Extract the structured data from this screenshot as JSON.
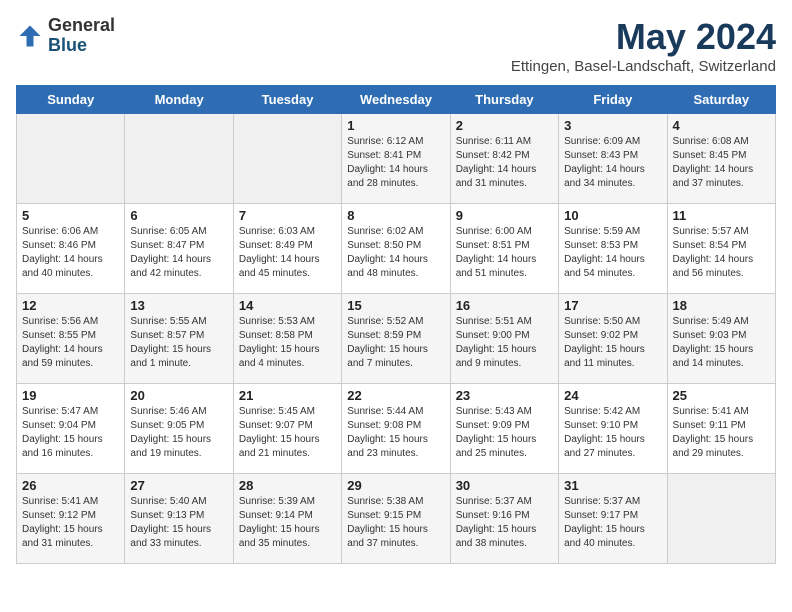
{
  "logo": {
    "general": "General",
    "blue": "Blue"
  },
  "title": "May 2024",
  "subtitle": "Ettingen, Basel-Landschaft, Switzerland",
  "days_of_week": [
    "Sunday",
    "Monday",
    "Tuesday",
    "Wednesday",
    "Thursday",
    "Friday",
    "Saturday"
  ],
  "weeks": [
    [
      {
        "day": "",
        "info": ""
      },
      {
        "day": "",
        "info": ""
      },
      {
        "day": "",
        "info": ""
      },
      {
        "day": "1",
        "info": "Sunrise: 6:12 AM\nSunset: 8:41 PM\nDaylight: 14 hours\nand 28 minutes."
      },
      {
        "day": "2",
        "info": "Sunrise: 6:11 AM\nSunset: 8:42 PM\nDaylight: 14 hours\nand 31 minutes."
      },
      {
        "day": "3",
        "info": "Sunrise: 6:09 AM\nSunset: 8:43 PM\nDaylight: 14 hours\nand 34 minutes."
      },
      {
        "day": "4",
        "info": "Sunrise: 6:08 AM\nSunset: 8:45 PM\nDaylight: 14 hours\nand 37 minutes."
      }
    ],
    [
      {
        "day": "5",
        "info": "Sunrise: 6:06 AM\nSunset: 8:46 PM\nDaylight: 14 hours\nand 40 minutes."
      },
      {
        "day": "6",
        "info": "Sunrise: 6:05 AM\nSunset: 8:47 PM\nDaylight: 14 hours\nand 42 minutes."
      },
      {
        "day": "7",
        "info": "Sunrise: 6:03 AM\nSunset: 8:49 PM\nDaylight: 14 hours\nand 45 minutes."
      },
      {
        "day": "8",
        "info": "Sunrise: 6:02 AM\nSunset: 8:50 PM\nDaylight: 14 hours\nand 48 minutes."
      },
      {
        "day": "9",
        "info": "Sunrise: 6:00 AM\nSunset: 8:51 PM\nDaylight: 14 hours\nand 51 minutes."
      },
      {
        "day": "10",
        "info": "Sunrise: 5:59 AM\nSunset: 8:53 PM\nDaylight: 14 hours\nand 54 minutes."
      },
      {
        "day": "11",
        "info": "Sunrise: 5:57 AM\nSunset: 8:54 PM\nDaylight: 14 hours\nand 56 minutes."
      }
    ],
    [
      {
        "day": "12",
        "info": "Sunrise: 5:56 AM\nSunset: 8:55 PM\nDaylight: 14 hours\nand 59 minutes."
      },
      {
        "day": "13",
        "info": "Sunrise: 5:55 AM\nSunset: 8:57 PM\nDaylight: 15 hours\nand 1 minute."
      },
      {
        "day": "14",
        "info": "Sunrise: 5:53 AM\nSunset: 8:58 PM\nDaylight: 15 hours\nand 4 minutes."
      },
      {
        "day": "15",
        "info": "Sunrise: 5:52 AM\nSunset: 8:59 PM\nDaylight: 15 hours\nand 7 minutes."
      },
      {
        "day": "16",
        "info": "Sunrise: 5:51 AM\nSunset: 9:00 PM\nDaylight: 15 hours\nand 9 minutes."
      },
      {
        "day": "17",
        "info": "Sunrise: 5:50 AM\nSunset: 9:02 PM\nDaylight: 15 hours\nand 11 minutes."
      },
      {
        "day": "18",
        "info": "Sunrise: 5:49 AM\nSunset: 9:03 PM\nDaylight: 15 hours\nand 14 minutes."
      }
    ],
    [
      {
        "day": "19",
        "info": "Sunrise: 5:47 AM\nSunset: 9:04 PM\nDaylight: 15 hours\nand 16 minutes."
      },
      {
        "day": "20",
        "info": "Sunrise: 5:46 AM\nSunset: 9:05 PM\nDaylight: 15 hours\nand 19 minutes."
      },
      {
        "day": "21",
        "info": "Sunrise: 5:45 AM\nSunset: 9:07 PM\nDaylight: 15 hours\nand 21 minutes."
      },
      {
        "day": "22",
        "info": "Sunrise: 5:44 AM\nSunset: 9:08 PM\nDaylight: 15 hours\nand 23 minutes."
      },
      {
        "day": "23",
        "info": "Sunrise: 5:43 AM\nSunset: 9:09 PM\nDaylight: 15 hours\nand 25 minutes."
      },
      {
        "day": "24",
        "info": "Sunrise: 5:42 AM\nSunset: 9:10 PM\nDaylight: 15 hours\nand 27 minutes."
      },
      {
        "day": "25",
        "info": "Sunrise: 5:41 AM\nSunset: 9:11 PM\nDaylight: 15 hours\nand 29 minutes."
      }
    ],
    [
      {
        "day": "26",
        "info": "Sunrise: 5:41 AM\nSunset: 9:12 PM\nDaylight: 15 hours\nand 31 minutes."
      },
      {
        "day": "27",
        "info": "Sunrise: 5:40 AM\nSunset: 9:13 PM\nDaylight: 15 hours\nand 33 minutes."
      },
      {
        "day": "28",
        "info": "Sunrise: 5:39 AM\nSunset: 9:14 PM\nDaylight: 15 hours\nand 35 minutes."
      },
      {
        "day": "29",
        "info": "Sunrise: 5:38 AM\nSunset: 9:15 PM\nDaylight: 15 hours\nand 37 minutes."
      },
      {
        "day": "30",
        "info": "Sunrise: 5:37 AM\nSunset: 9:16 PM\nDaylight: 15 hours\nand 38 minutes."
      },
      {
        "day": "31",
        "info": "Sunrise: 5:37 AM\nSunset: 9:17 PM\nDaylight: 15 hours\nand 40 minutes."
      },
      {
        "day": "",
        "info": ""
      }
    ]
  ]
}
